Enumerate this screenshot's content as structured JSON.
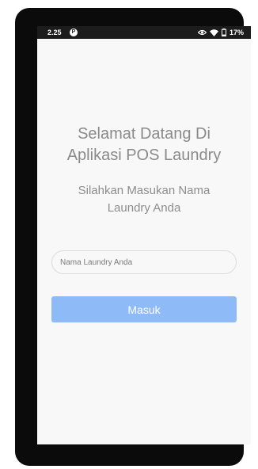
{
  "status_bar": {
    "time": "2.25",
    "app_icon_letter": "P",
    "battery_text": "17%"
  },
  "welcome": {
    "title_line1": "Selamat Datang Di",
    "title_line2": "Aplikasi POS Laundry",
    "subtitle_line1": "Silahkan Masukan Nama",
    "subtitle_line2": "Laundry Anda"
  },
  "form": {
    "laundry_name_placeholder": "Nama Laundry Anda",
    "laundry_name_value": "",
    "submit_label": "Masuk"
  },
  "colors": {
    "button_background": "#8fbaf8",
    "screen_background": "#f8f8f8",
    "title_text": "#8a8a8a"
  },
  "icons": [
    "eye-icon",
    "wifi-icon",
    "battery-icon"
  ]
}
